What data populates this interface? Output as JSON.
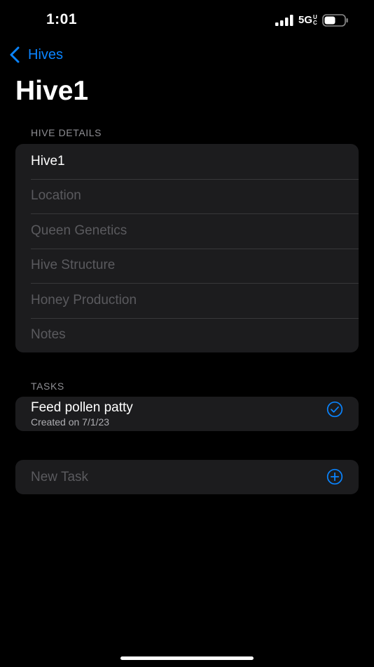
{
  "status_bar": {
    "time": "1:01",
    "network": "5G",
    "network_suffix": "UC",
    "icons": [
      "signal-bars-icon",
      "battery-icon"
    ]
  },
  "nav": {
    "back_label": "Hives",
    "back_icon": "chevron-left-icon",
    "title": "Hive1"
  },
  "colors": {
    "accent": "#0a84ff",
    "background": "#000000",
    "group_background": "#1c1c1e",
    "placeholder": "#5a5a5e",
    "section_header": "#8e8e93"
  },
  "details": {
    "header": "HIVE DETAILS",
    "fields": [
      {
        "value": "Hive1",
        "placeholder": ""
      },
      {
        "value": "",
        "placeholder": "Location"
      },
      {
        "value": "",
        "placeholder": "Queen Genetics"
      },
      {
        "value": "",
        "placeholder": "Hive Structure"
      },
      {
        "value": "",
        "placeholder": "Honey Production"
      },
      {
        "value": "",
        "placeholder": "Notes"
      }
    ]
  },
  "tasks": {
    "header": "TASKS",
    "items": [
      {
        "title": "Feed pollen patty",
        "subtitle": "Created on 7/1/23",
        "icon": "checkmark-circle-icon"
      }
    ],
    "new_task": {
      "placeholder": "New Task",
      "icon": "plus-circle-icon"
    }
  }
}
